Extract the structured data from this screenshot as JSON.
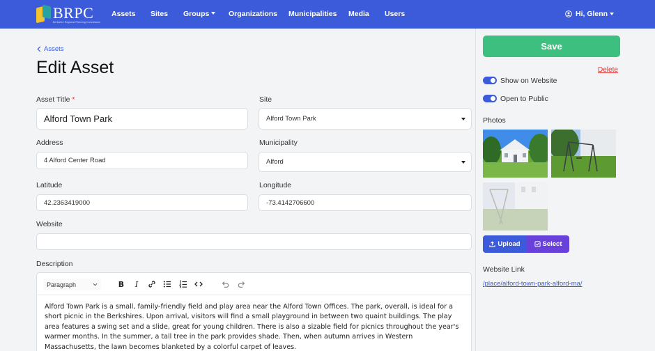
{
  "brand": {
    "name": "BRPC",
    "tagline": "Berkshire Regional Planning Commission"
  },
  "nav": {
    "assets": "Assets",
    "sites": "Sites",
    "groups": "Groups",
    "organizations": "Organizations",
    "municipalities": "Municipalities",
    "media": "Media",
    "users": "Users",
    "user_greeting": "Hi, Glenn"
  },
  "breadcrumb": {
    "back_label": "Assets"
  },
  "page": {
    "title": "Edit Asset"
  },
  "form": {
    "asset_title": {
      "label": "Asset Title",
      "required_mark": "*",
      "value": "Alford Town Park"
    },
    "site": {
      "label": "Site",
      "value": "Alford Town Park"
    },
    "address": {
      "label": "Address",
      "value": "4 Alford Center Road"
    },
    "municipality": {
      "label": "Municipality",
      "value": "Alford"
    },
    "latitude": {
      "label": "Latitude",
      "value": "42.2363419000"
    },
    "longitude": {
      "label": "Longitude",
      "value": "-73.4142706600"
    },
    "website": {
      "label": "Website",
      "value": ""
    },
    "description": {
      "label": "Description",
      "block_format": "Paragraph",
      "text": "Alford Town Park is a small, family-friendly field and play area near the Alford Town Offices. The park, overall, is ideal for a short picnic in the Berkshires. Upon arrival, visitors will find a small playground in between two quaint buildings. The play area features a swing set and a slide, great for young children. There is also a sizable field for picnics throughout the year's warmer months. In the summer, a tall tree in the park provides shade. Then, when autumn arrives in Western Massachusetts, the lawn becomes blanketed by a colorful carpet of leaves."
    }
  },
  "sidebar": {
    "save_label": "Save",
    "delete_label": "Delete",
    "show_on_website": {
      "label": "Show on Website",
      "checked": true
    },
    "open_to_public": {
      "label": "Open to Public",
      "checked": true
    },
    "photos_heading": "Photos",
    "upload_label": "Upload",
    "select_label": "Select",
    "website_link_heading": "Website Link",
    "website_link": "/place/alford-town-park-alford-ma/"
  },
  "colors": {
    "navbar": "#3b5bdb",
    "save": "#3dbf7f",
    "delete": "#e03131",
    "upload": "#3b5bdb",
    "select": "#6741d9"
  }
}
